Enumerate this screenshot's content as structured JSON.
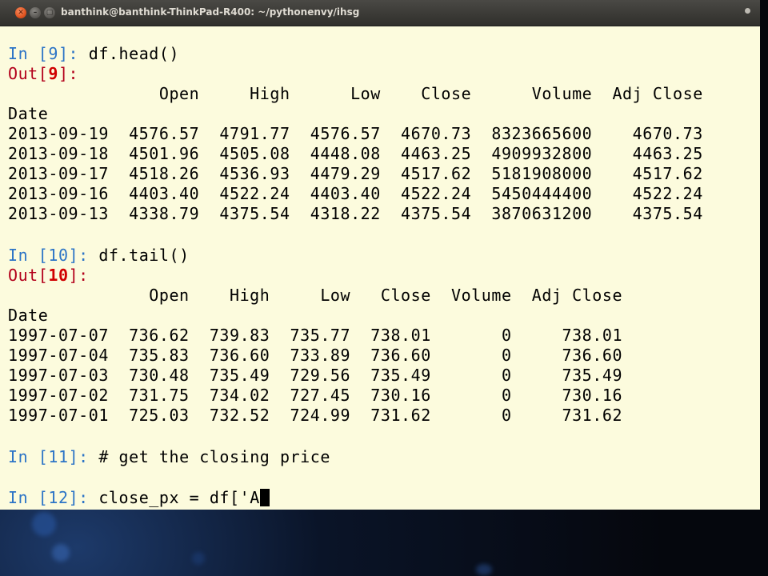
{
  "window": {
    "title": "banthink@banthink-ThinkPad-R400: ~/pythonenvy/ihsg",
    "close_glyph": "✕",
    "min_glyph": "–",
    "max_glyph": "▢"
  },
  "colors": {
    "terminal_bg": "#fcfbdd",
    "in_prompt": "#2c74c6",
    "out_prompt": "#b3001b"
  },
  "session": {
    "in9": {
      "prefix": "In [",
      "num": "9",
      "suffix": "]: ",
      "code": "df.head()"
    },
    "out9": {
      "prefix": "Out[",
      "num": "9",
      "suffix": "]:"
    },
    "head_table": {
      "header": "               Open     High      Low    Close      Volume  Adj Close",
      "index_label": "Date",
      "rows": [
        "2013-09-19  4576.57  4791.77  4576.57  4670.73  8323665600    4670.73",
        "2013-09-18  4501.96  4505.08  4448.08  4463.25  4909932800    4463.25",
        "2013-09-17  4518.26  4536.93  4479.29  4517.62  5181908000    4517.62",
        "2013-09-16  4403.40  4522.24  4403.40  4522.24  5450444400    4522.24",
        "2013-09-13  4338.79  4375.54  4318.22  4375.54  3870631200    4375.54"
      ]
    },
    "in10": {
      "prefix": "In [",
      "num": "10",
      "suffix": "]: ",
      "code": "df.tail()"
    },
    "out10": {
      "prefix": "Out[",
      "num": "10",
      "suffix": "]:"
    },
    "tail_table": {
      "header": "              Open    High     Low   Close  Volume  Adj Close",
      "index_label": "Date",
      "rows": [
        "1997-07-07  736.62  739.83  735.77  738.01       0     738.01",
        "1997-07-04  735.83  736.60  733.89  736.60       0     736.60",
        "1997-07-03  730.48  735.49  729.56  735.49       0     735.49",
        "1997-07-02  731.75  734.02  727.45  730.16       0     730.16",
        "1997-07-01  725.03  732.52  724.99  731.62       0     731.62"
      ]
    },
    "in11": {
      "prefix": "In [",
      "num": "11",
      "suffix": "]: ",
      "code": "# get the closing price"
    },
    "in12": {
      "prefix": "In [",
      "num": "12",
      "suffix": "]: ",
      "code": "close_px = df['A"
    }
  }
}
